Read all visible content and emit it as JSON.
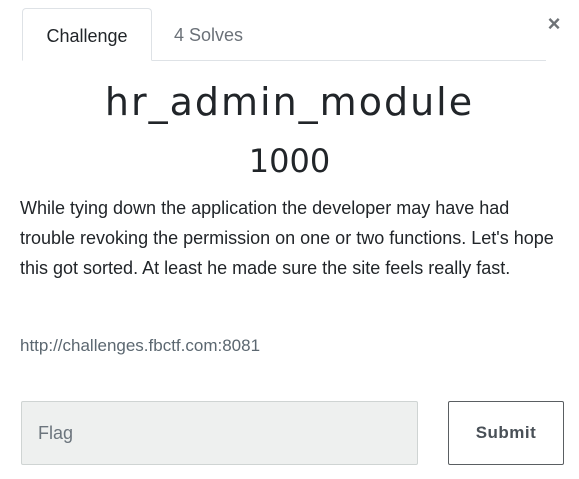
{
  "tabs": [
    {
      "label": "Challenge",
      "active": true
    },
    {
      "label": "4 Solves",
      "active": false
    }
  ],
  "close_glyph": "×",
  "challenge": {
    "name": "hr_admin_module",
    "value": "1000",
    "description": "While tying down the application the developer may have had trouble revoking the permission on one or two functions. Let's hope this got sorted. At least he made sure the site feels really fast.",
    "link": "http://challenges.fbctf.com:8081"
  },
  "form": {
    "flag_placeholder": "Flag",
    "flag_value": "",
    "submit_label": "Submit"
  },
  "colors": {
    "input_bg": "#eef0ef",
    "link": "#5b6770",
    "text": "#212529"
  }
}
